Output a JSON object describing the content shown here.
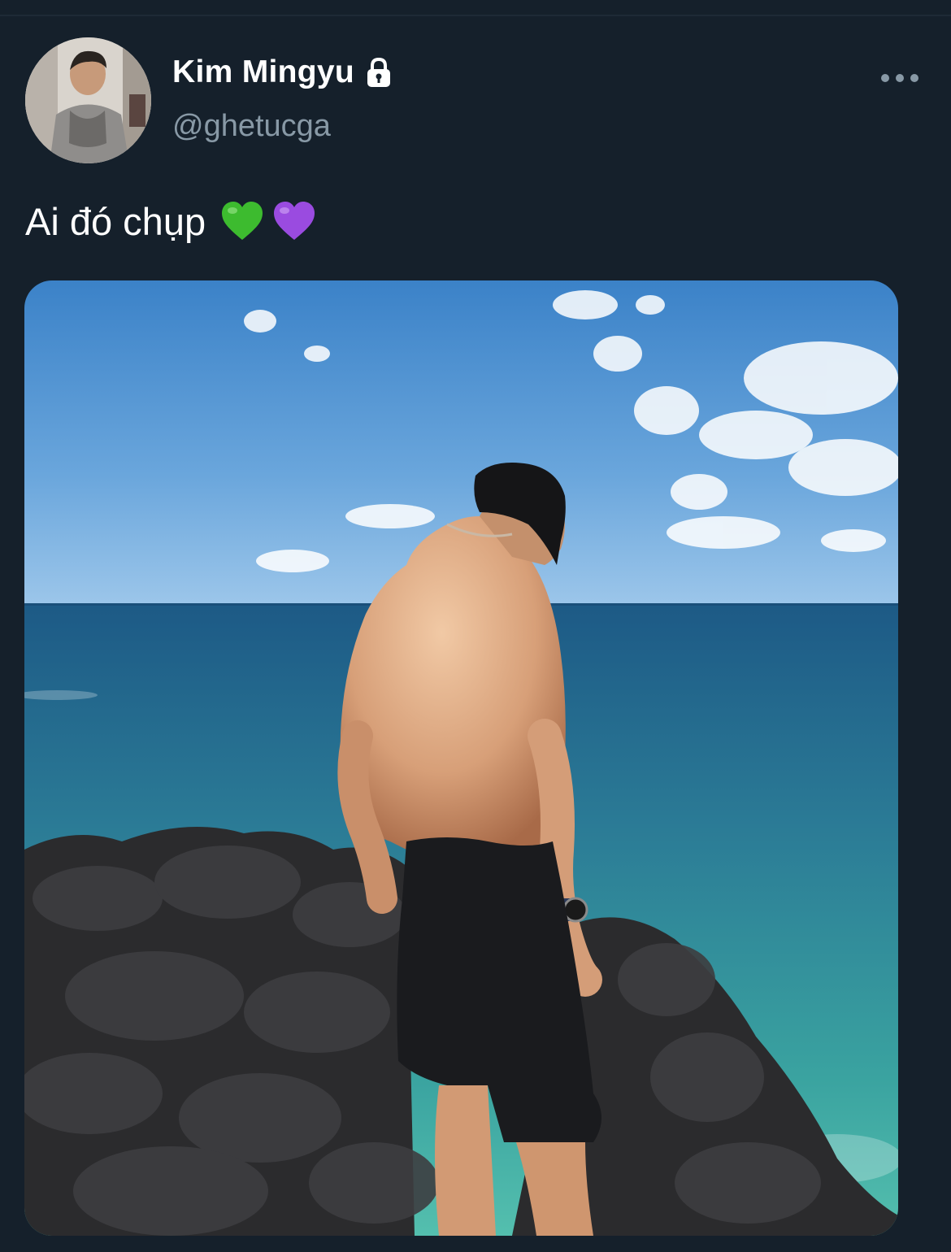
{
  "tweet": {
    "author": {
      "display_name": "Kim Mingyu",
      "handle": "@ghetucga",
      "avatar_icon": "profile-photo",
      "protected_icon": "lock-icon"
    },
    "text": "Ai đó chụp",
    "emojis": [
      "green-heart",
      "purple-heart"
    ],
    "more_icon": "more-horizontal-icon",
    "media_description_icon": "photo"
  },
  "colors": {
    "background": "#15202b",
    "secondary_text": "#8899a6",
    "primary_text": "#ffffff",
    "green_heart": "#3dbb2f",
    "purple_heart": "#9a4be0"
  }
}
